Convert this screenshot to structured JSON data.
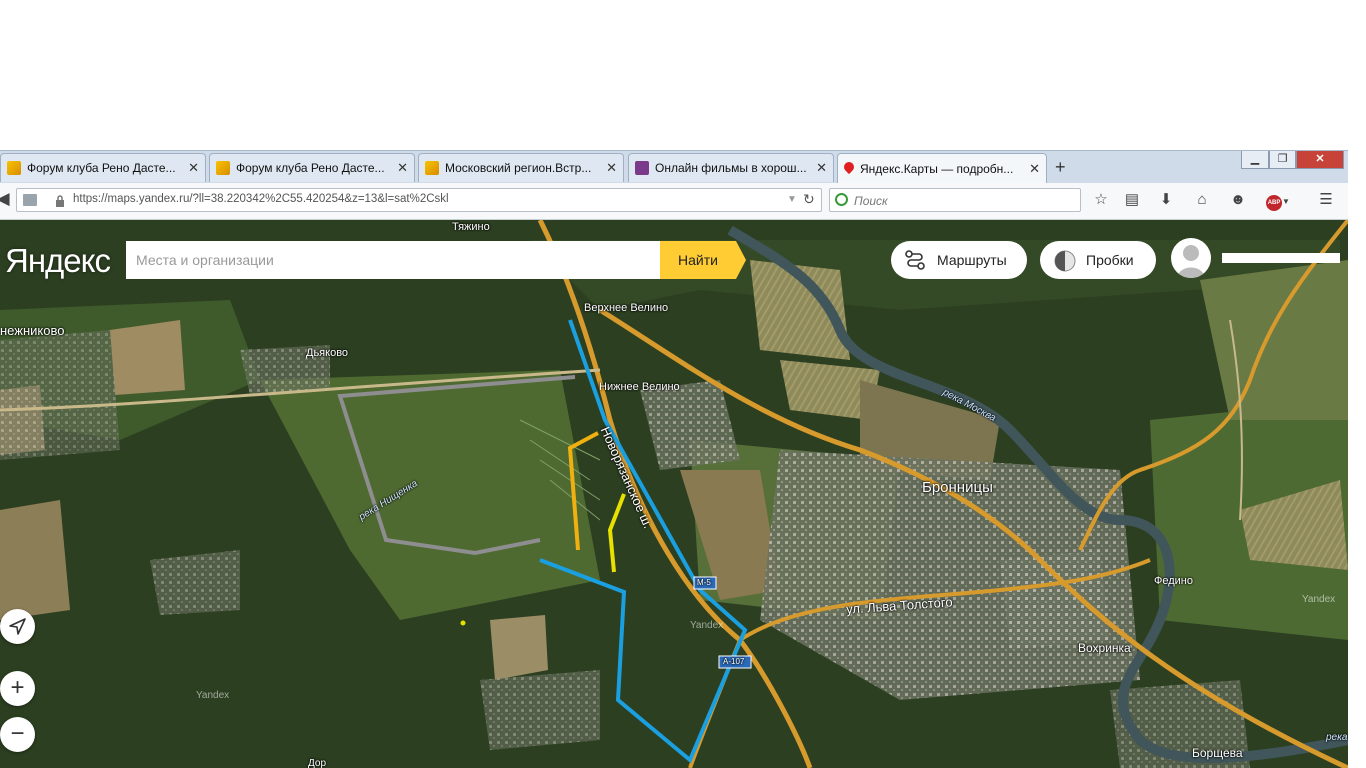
{
  "browser": {
    "tabs": [
      {
        "label": "Форум клуба Рено Дасте...",
        "icon": "forum-favicon"
      },
      {
        "label": "Форум клуба Рено Дасте...",
        "icon": "forum-favicon"
      },
      {
        "label": "Московский регион.Встр...",
        "icon": "forum-favicon"
      },
      {
        "label": "Онлайн фильмы в хорош...",
        "icon": "film-favicon"
      },
      {
        "label": "Яндекс.Карты — подробн...",
        "icon": "map-pin-favicon"
      }
    ],
    "new_tab_symbol": "+",
    "url": "https://maps.yandex.ru/?ll=38.220342%2C55.420254&z=13&l=sat%2Cskl",
    "search_placeholder": "Поиск"
  },
  "map_ui": {
    "logo": "Яндекс",
    "search_placeholder": "Места и организации",
    "search_button": "Найти",
    "routes_button": "Маршруты",
    "traffic_button": "Пробки",
    "zoom_in": "+",
    "zoom_out": "−"
  },
  "map_labels": {
    "tyazhino": "Тяжино",
    "verkhnee_velino": "Верхнее Велино",
    "nizhnee_velino": "Нижнее Велино",
    "snezhnikovo": "нежниково",
    "dyakovo": "Дьяково",
    "bronnitsy": "Бронницы",
    "reka_moskva": "река Москва",
    "reka_nishchenka": "река Нищенка",
    "novoryazanskoe": "Новорязанское ш.",
    "m5": "М-5",
    "a107": "А-107",
    "lva_tolstogo": "ул. Льва Толстого",
    "fedino": "Федино",
    "vokhrinka": "Вохринка",
    "borsheva": "Борщева",
    "dor": "Дор",
    "reka_edge": "река",
    "wm1": "Yandex",
    "wm2": "Yandex",
    "wm3": "Yandex"
  }
}
